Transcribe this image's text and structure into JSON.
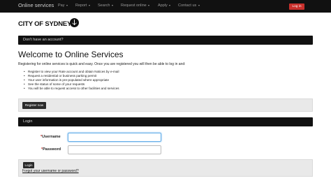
{
  "navbar": {
    "brand": "Online services",
    "items": [
      {
        "label": "Pay"
      },
      {
        "label": "Report"
      },
      {
        "label": "Search"
      },
      {
        "label": "Request online"
      },
      {
        "label": "Apply"
      },
      {
        "label": "Contact us"
      }
    ],
    "login_label": "Log in"
  },
  "logo": {
    "text": "CITY OF SYDNEY"
  },
  "no_account_bar": {
    "label": "Don't have an account?"
  },
  "main": {
    "title": "Welcome to Online Services",
    "intro": "Registering for online services is quick and easy. Once you are registered you will then be able to log in and:",
    "bullets": [
      "Register to view your Rate account and obtain Notices by e-mail",
      "Request a residential or business parking permit",
      "Your user information is pre-populated where appropriate",
      "See the status of some of your requests",
      "You will be able to request access to other facilities and services"
    ],
    "register_label": "Register now"
  },
  "login_panel": {
    "header": "Login",
    "username_label": "Username",
    "password_label": "Password",
    "required_mark": "*",
    "username_value": "",
    "password_value": "",
    "login_button": "Login",
    "forgot_link": "Forgot your username or password?"
  },
  "colors": {
    "navbar_bg": "#111111",
    "login_btn": "#c9302c",
    "well_bg": "#e9e9e9",
    "focus": "#66afe9"
  }
}
